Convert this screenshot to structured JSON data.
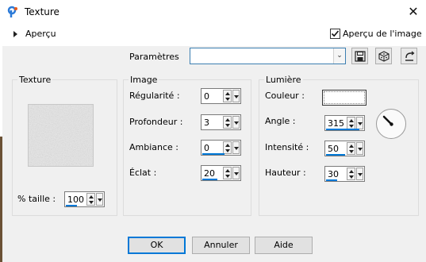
{
  "window": {
    "title": "Texture",
    "close_glyph": "✕"
  },
  "apercu": {
    "label": "Aperçu",
    "checkbox_label": "Aperçu de l'image",
    "checkbox_checked": true
  },
  "params": {
    "label": "Paramètres",
    "value": ""
  },
  "texture_group": {
    "title": "Texture",
    "taille_label": "% taille :",
    "taille_value": "100",
    "taille_fill": 0.3
  },
  "image_group": {
    "title": "Image",
    "fields": [
      {
        "label": "Régularité :",
        "value": "0",
        "fill": 0.0
      },
      {
        "label": "Profondeur :",
        "value": "3",
        "fill": 0.0
      },
      {
        "label": "Ambiance :",
        "value": "0",
        "fill": 0.6
      },
      {
        "label": "Éclat :",
        "value": "20",
        "fill": 0.4
      }
    ]
  },
  "lumiere_group": {
    "title": "Lumière",
    "couleur_label": "Couleur :",
    "swatch_color": "#ffffff",
    "fields": [
      {
        "label": "Angle :",
        "value": "315",
        "fill": 0.9
      },
      {
        "label": "Intensité :",
        "value": "50",
        "fill": 0.5
      },
      {
        "label": "Hauteur :",
        "value": "30",
        "fill": 0.3
      }
    ]
  },
  "buttons": {
    "ok": "OK",
    "annuler": "Annuler",
    "aide": "Aide"
  },
  "colors": {
    "accent": "#0078d7",
    "panel_bg": "#f0f0f0"
  }
}
